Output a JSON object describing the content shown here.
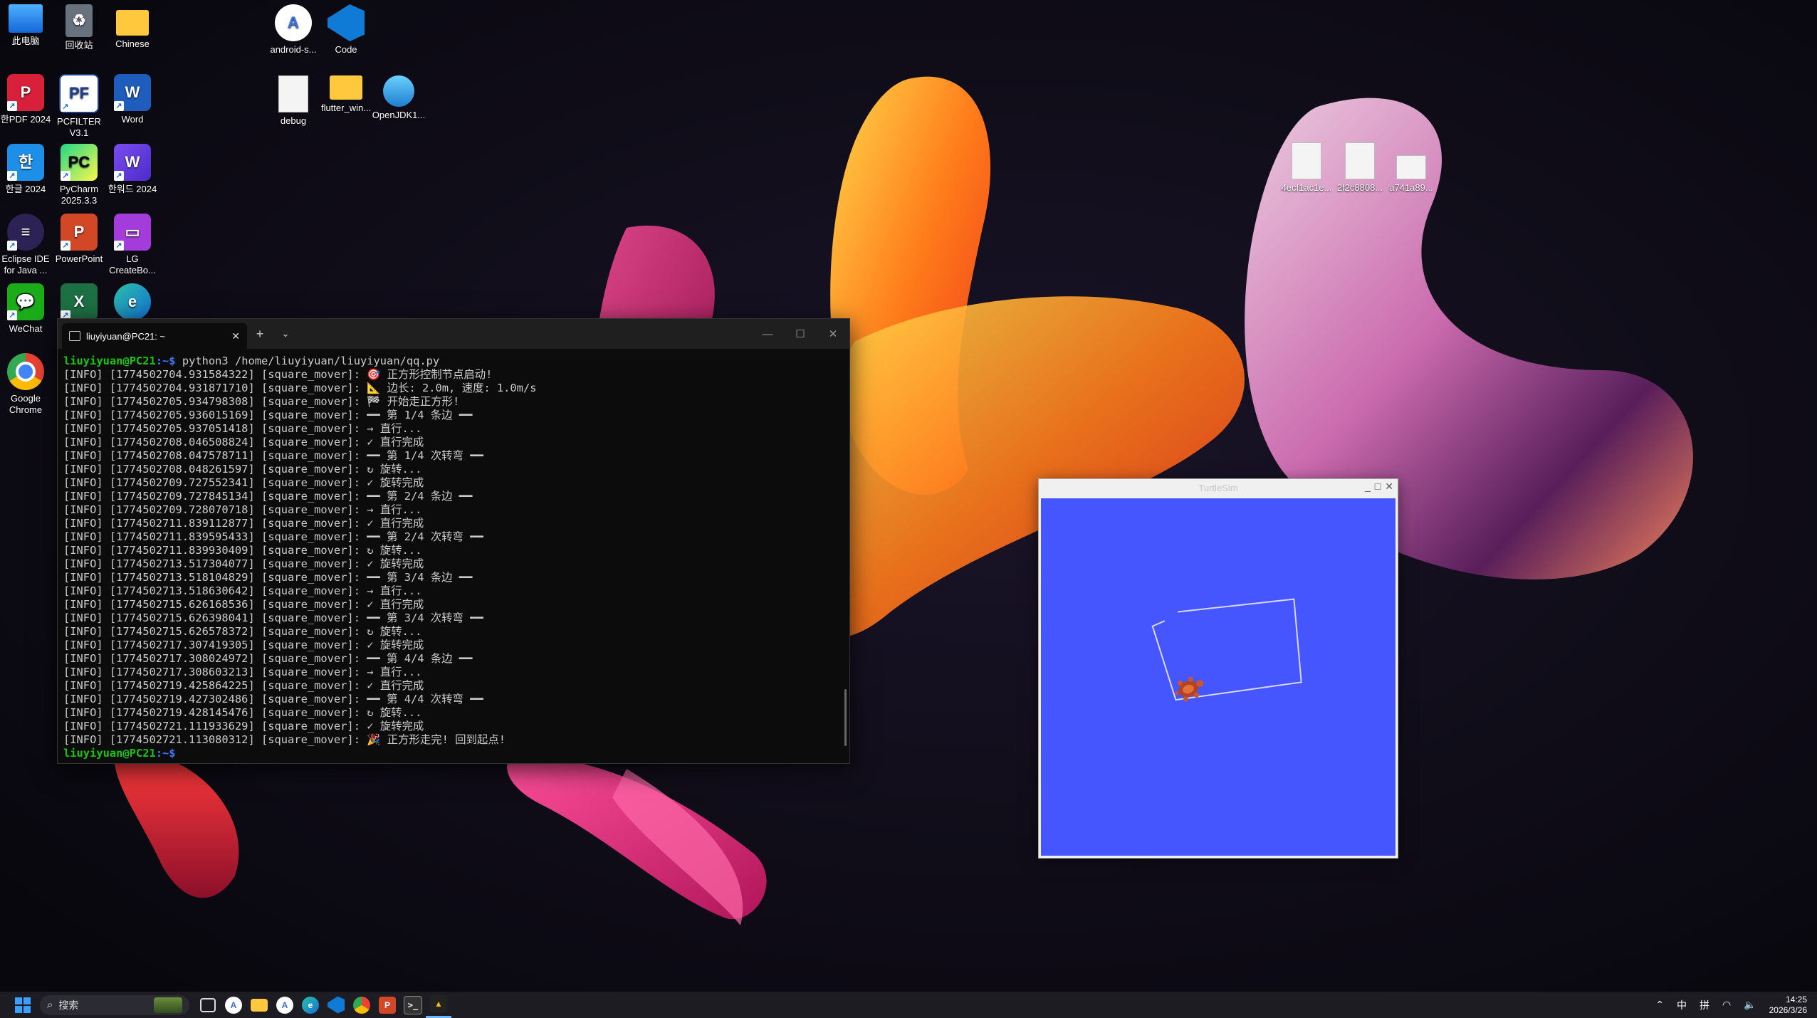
{
  "desktop": {
    "icons": [
      {
        "label": "此电脑"
      },
      {
        "label": "回收站"
      },
      {
        "label": "Chinese"
      },
      {
        "label": "한PDF 2024"
      },
      {
        "label": "PCFILTER V3.1"
      },
      {
        "label": "Word"
      },
      {
        "label": "한글 2024"
      },
      {
        "label": "PyCharm 2025.3.3"
      },
      {
        "label": "한워드 2024"
      },
      {
        "label": "Eclipse IDE for Java ..."
      },
      {
        "label": "PowerPoint"
      },
      {
        "label": "LG CreateBo..."
      },
      {
        "label": "WeChat"
      },
      {
        "label": "Google Chrome"
      },
      {
        "label": "android-s..."
      },
      {
        "label": "Code"
      },
      {
        "label": "debug"
      },
      {
        "label": "flutter_win..."
      },
      {
        "label": "OpenJDK1..."
      },
      {
        "label": "4ecf1ac1e..."
      },
      {
        "label": "2f2c8808..."
      },
      {
        "label": "a741a89..."
      }
    ]
  },
  "terminal": {
    "tab_title": "liuyiyuan@PC21: ~",
    "prompt_user": "liuyiyuan@PC21",
    "prompt_path": ":~$",
    "command": " python3 /home/liuyiyuan/liuyiyuan/qq.py",
    "lines": [
      "[INFO] [1774502704.931584322] [square_mover]: 🎯 正方形控制节点启动!",
      "[INFO] [1774502704.931871710] [square_mover]: 📐 边长: 2.0m, 速度: 1.0m/s",
      "[INFO] [1774502705.934798308] [square_mover]: 🏁 开始走正方形!",
      "[INFO] [1774502705.936015169] [square_mover]: ━━ 第 1/4 条边 ━━",
      "[INFO] [1774502705.937051418] [square_mover]: → 直行...",
      "[INFO] [1774502708.046508824] [square_mover]: ✓ 直行完成",
      "[INFO] [1774502708.047578711] [square_mover]: ━━ 第 1/4 次转弯 ━━",
      "[INFO] [1774502708.048261597] [square_mover]: ↻ 旋转...",
      "[INFO] [1774502709.727552341] [square_mover]: ✓ 旋转完成",
      "[INFO] [1774502709.727845134] [square_mover]: ━━ 第 2/4 条边 ━━",
      "[INFO] [1774502709.728070718] [square_mover]: → 直行...",
      "[INFO] [1774502711.839112877] [square_mover]: ✓ 直行完成",
      "[INFO] [1774502711.839595433] [square_mover]: ━━ 第 2/4 次转弯 ━━",
      "[INFO] [1774502711.839930409] [square_mover]: ↻ 旋转...",
      "[INFO] [1774502713.517304077] [square_mover]: ✓ 旋转完成",
      "[INFO] [1774502713.518104829] [square_mover]: ━━ 第 3/4 条边 ━━",
      "[INFO] [1774502713.518630642] [square_mover]: → 直行...",
      "[INFO] [1774502715.626168536] [square_mover]: ✓ 直行完成",
      "[INFO] [1774502715.626398041] [square_mover]: ━━ 第 3/4 次转弯 ━━",
      "[INFO] [1774502715.626578372] [square_mover]: ↻ 旋转...",
      "[INFO] [1774502717.307419305] [square_mover]: ✓ 旋转完成",
      "[INFO] [1774502717.308024972] [square_mover]: ━━ 第 4/4 条边 ━━",
      "[INFO] [1774502717.308603213] [square_mover]: → 直行...",
      "[INFO] [1774502719.425864225] [square_mover]: ✓ 直行完成",
      "[INFO] [1774502719.427302486] [square_mover]: ━━ 第 4/4 次转弯 ━━",
      "[INFO] [1774502719.428145476] [square_mover]: ↻ 旋转...",
      "[INFO] [1774502721.111933629] [square_mover]: ✓ 旋转完成",
      "[INFO] [1774502721.113080312] [square_mover]: 🎉 正方形走完! 回到起点!"
    ],
    "final_prompt_user": "liuyiyuan@PC21",
    "final_prompt_path": ":~$"
  },
  "turtlesim": {
    "title": "TurtleSim",
    "background_color": "#4556ff"
  },
  "taskbar": {
    "search_placeholder": "搜索",
    "ime": "中",
    "ime_mode": "拼",
    "time": "14:25",
    "date": "2026/3/26"
  }
}
